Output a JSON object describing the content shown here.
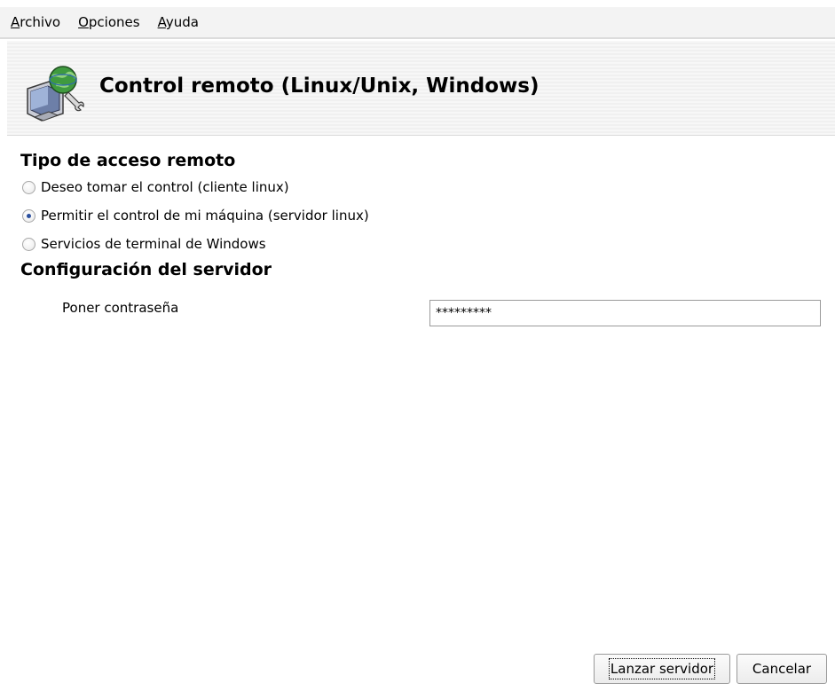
{
  "menubar": {
    "items": [
      {
        "first": "A",
        "rest": "rchivo"
      },
      {
        "first": "O",
        "rest": "pciones"
      },
      {
        "first": "A",
        "rest": "yuda"
      }
    ]
  },
  "header": {
    "title": "Control remoto (Linux/Unix, Windows)",
    "icon": "remote-control-computer-icon"
  },
  "access": {
    "title": "Tipo de acceso remoto",
    "options": [
      {
        "label": "Deseo tomar el control (cliente linux)",
        "checked": false
      },
      {
        "label": "Permitir el control de mi máquina (servidor linux)",
        "checked": true
      },
      {
        "label": "Servicios de terminal de Windows",
        "checked": false
      }
    ]
  },
  "server": {
    "title": "Configuración del servidor",
    "password_label": "Poner contraseña",
    "password_value": "*********"
  },
  "buttons": {
    "launch": "Lanzar servidor",
    "cancel": "Cancelar"
  },
  "colors": {
    "radio_dot": "#2a4f9e",
    "banner": "#f3f3f3"
  }
}
